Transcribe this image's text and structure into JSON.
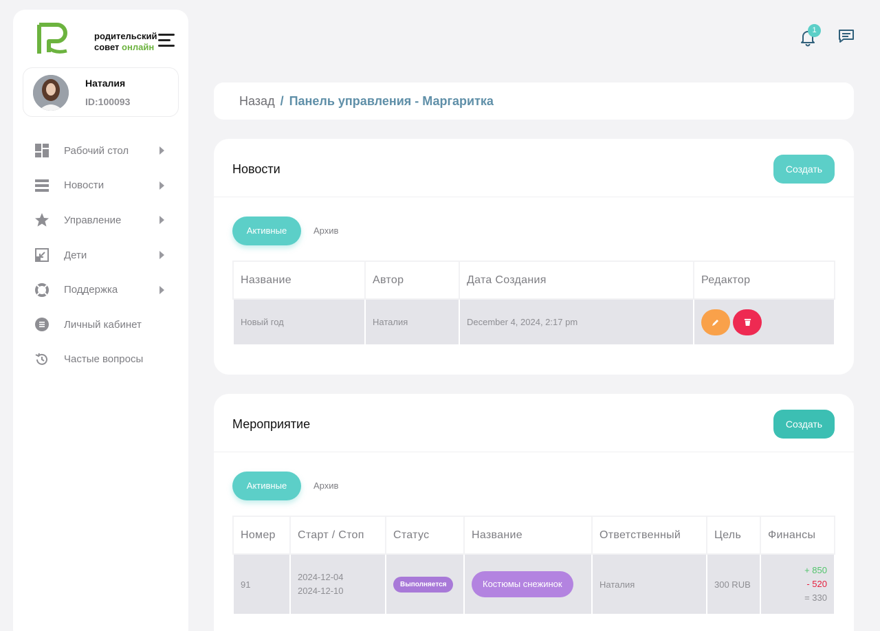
{
  "brand": {
    "line1": "родительский",
    "line2_word1": "совет",
    "line2_word2": "онлайн"
  },
  "user": {
    "name": "Наталия",
    "id": "ID:100093"
  },
  "nav": [
    {
      "label": "Рабочий стол",
      "icon": "dashboard-icon",
      "has_arrow": true
    },
    {
      "label": "Новости",
      "icon": "list-icon",
      "has_arrow": true
    },
    {
      "label": "Управление",
      "icon": "star-icon",
      "has_arrow": true
    },
    {
      "label": "Дети",
      "icon": "collapse-icon",
      "has_arrow": true
    },
    {
      "label": "Поддержка",
      "icon": "lifebuoy-icon",
      "has_arrow": true
    },
    {
      "label": "Личный кабинет",
      "icon": "document-icon",
      "has_arrow": false
    },
    {
      "label": "Частые вопросы",
      "icon": "history-icon",
      "has_arrow": false
    }
  ],
  "header": {
    "notification_count": "1"
  },
  "breadcrumb": {
    "back": "Назад",
    "separator": "/",
    "current": "Панель управления - Маргаритка"
  },
  "news": {
    "title": "Новости",
    "create_label": "Создать",
    "tab_active": "Активные",
    "tab_archive": "Архив",
    "columns": [
      "Название",
      "Автор",
      "Дата Создания",
      "Редактор"
    ],
    "rows": [
      {
        "name": "Новый год",
        "author": "Наталия",
        "date": "December 4, 2024, 2:17 pm"
      }
    ]
  },
  "events": {
    "title": "Мероприятие",
    "create_label": "Создать",
    "tab_active": "Активные",
    "tab_archive": "Архив",
    "columns": [
      "Номер",
      "Старт / Стоп",
      "Статус",
      "Название",
      "Ответственный",
      "Цель",
      "Финансы"
    ],
    "rows": [
      {
        "number": "91",
        "start": "2024-12-04",
        "stop": "2024-12-10",
        "status": "Выполняется",
        "name": "Костюмы снежинок",
        "responsible": "Наталия",
        "goal": "300 RUB",
        "fin_plus": "+ 850",
        "fin_minus": "- 520",
        "fin_total": "= 330"
      }
    ]
  },
  "colors": {
    "accent": "#5ccfc8",
    "accent_dark": "#3cbfb3",
    "edit": "#f9a14a",
    "delete": "#ee2a52",
    "status": "#a879d8",
    "brand_green": "#6cb33f"
  }
}
